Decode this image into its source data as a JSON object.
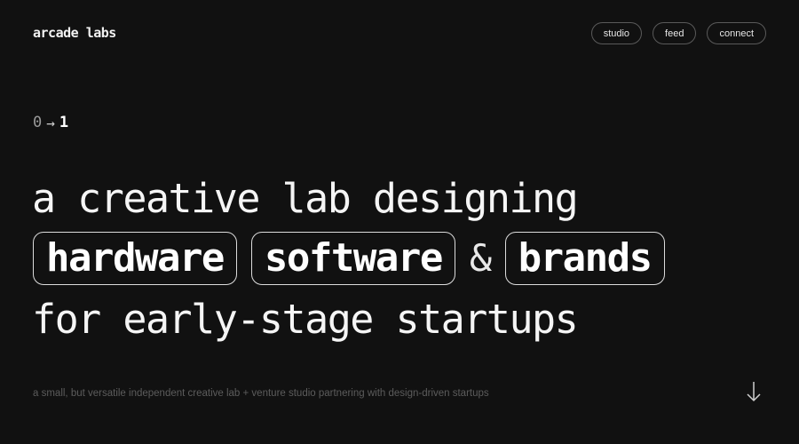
{
  "header": {
    "logo": "arcade labs",
    "nav": [
      {
        "label": "studio"
      },
      {
        "label": "feed"
      },
      {
        "label": "connect"
      }
    ]
  },
  "hero": {
    "counter": {
      "from": "0",
      "arrow": "→",
      "to": "1"
    },
    "line1": "a creative lab designing",
    "line2": {
      "pill1": "hardware",
      "pill2": "software",
      "ampersand": "&",
      "pill3": "brands"
    },
    "line3": "for early-stage startups",
    "tagline": "a small, but versatile independent creative lab + venture studio partnering with design-driven startups"
  },
  "icons": {
    "scroll": "arrow-down-icon"
  },
  "colors": {
    "background": "#111111",
    "foreground": "#f5f5f5",
    "muted": "#5c5c5c",
    "border": "#5a5a5a"
  }
}
